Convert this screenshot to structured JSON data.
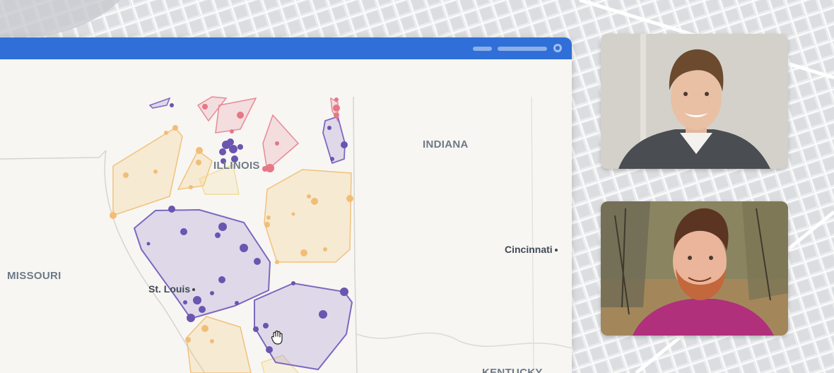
{
  "map": {
    "labels": {
      "illinois": "ILLINOIS",
      "indiana": "INDIANA",
      "missouri": "MISSOURI",
      "kentucky": "KENTUCKY"
    },
    "cities": {
      "st_louis": "St. Louis",
      "cincinnati": "Cincinnati"
    }
  },
  "colors": {
    "titlebar": "#2f6fd7",
    "purple_cluster": "#6a55b0",
    "orange_cluster": "#f0b461",
    "pink_cluster": "#e06a78"
  },
  "icons": {
    "cursor": "grab-hand-icon",
    "window_control": "record-dot-icon"
  }
}
